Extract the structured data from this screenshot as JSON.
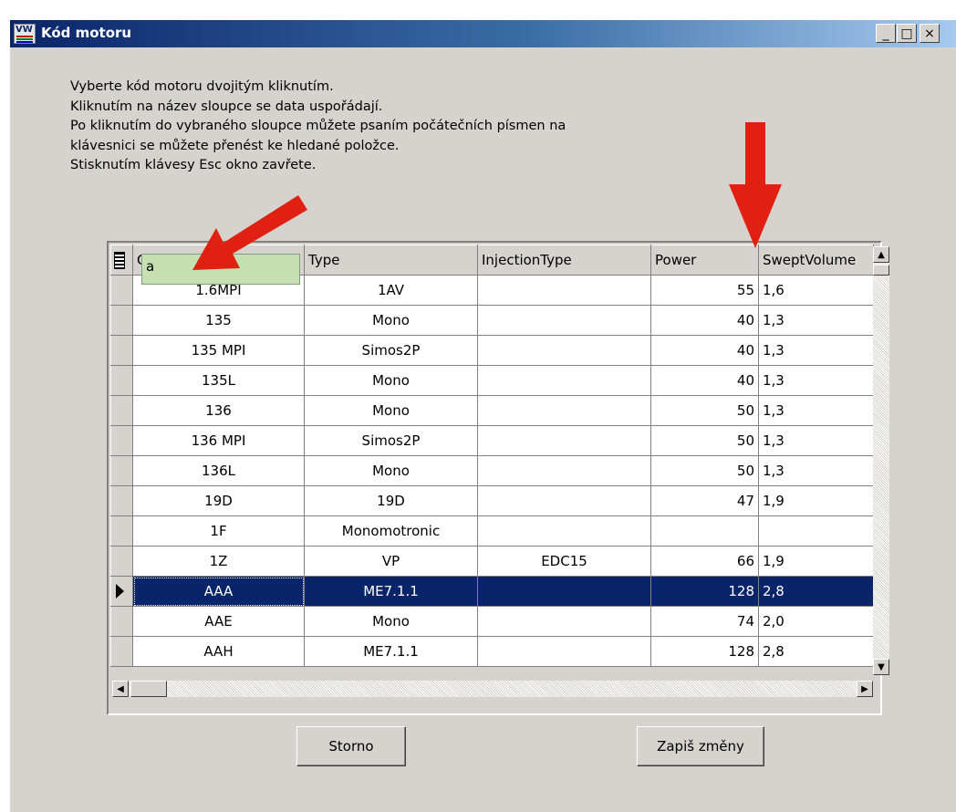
{
  "window": {
    "title": "Kód motoru",
    "icon_label": "VW",
    "controls": {
      "minimize": "_",
      "maximize": "□",
      "close": "×"
    }
  },
  "instructions": [
    "Vyberte kód motoru dvojitým kliknutím.",
    "Kliknutím na název sloupce se data uspořádají.",
    "Po kliknutím do vybraného sloupce můžete psaním počátečních písmen na",
    "klávesnici se můžete přenést ke hledané položce.",
    "Stisknutím klávesy Esc okno zavřete."
  ],
  "grid": {
    "columns": [
      "Code",
      "Type",
      "InjectionType",
      "Power",
      "SweptVolume"
    ],
    "search_text": "a",
    "rows": [
      {
        "code": "1.6MPI",
        "type": "1AV",
        "injection": "",
        "power": "55",
        "swept": "1,6"
      },
      {
        "code": "135",
        "type": "Mono",
        "injection": "",
        "power": "40",
        "swept": "1,3"
      },
      {
        "code": "135 MPI",
        "type": "Simos2P",
        "injection": "",
        "power": "40",
        "swept": "1,3"
      },
      {
        "code": "135L",
        "type": "Mono",
        "injection": "",
        "power": "40",
        "swept": "1,3"
      },
      {
        "code": "136",
        "type": "Mono",
        "injection": "",
        "power": "50",
        "swept": "1,3"
      },
      {
        "code": "136 MPI",
        "type": "Simos2P",
        "injection": "",
        "power": "50",
        "swept": "1,3"
      },
      {
        "code": "136L",
        "type": "Mono",
        "injection": "",
        "power": "50",
        "swept": "1,3"
      },
      {
        "code": "19D",
        "type": "19D",
        "injection": "",
        "power": "47",
        "swept": "1,9"
      },
      {
        "code": "1F",
        "type": "Monomotronic",
        "injection": "",
        "power": "",
        "swept": ""
      },
      {
        "code": "1Z",
        "type": "VP",
        "injection": "EDC15",
        "power": "66",
        "swept": "1,9"
      },
      {
        "code": "AAA",
        "type": "ME7.1.1",
        "injection": "",
        "power": "128",
        "swept": "2,8"
      },
      {
        "code": "AAE",
        "type": "Mono",
        "injection": "",
        "power": "74",
        "swept": "2,0"
      },
      {
        "code": "AAH",
        "type": "ME7.1.1",
        "injection": "",
        "power": "128",
        "swept": "2,8"
      }
    ],
    "selected_row_index": 10
  },
  "buttons": {
    "cancel": "Storno",
    "save": "Zapiš změny"
  },
  "colors": {
    "title_gradient_start": "#0a246a",
    "selection": "#0a246a",
    "annotation_arrow": "#e02010",
    "search_popup": "#c6e0b4",
    "face": "#d6d3ce"
  }
}
